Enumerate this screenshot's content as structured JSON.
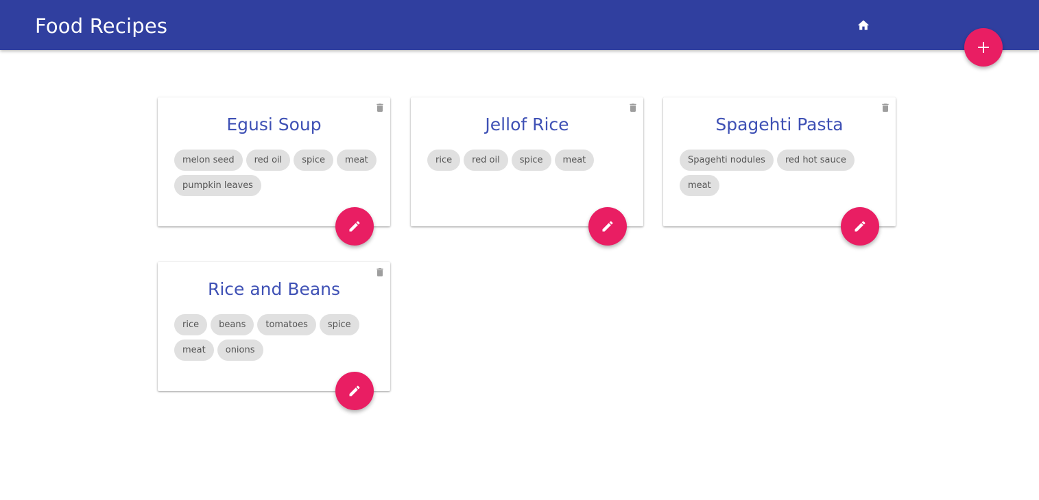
{
  "app": {
    "title": "Food Recipes",
    "home_icon": "home-icon",
    "add_icon": "plus-icon",
    "primary_color": "#303f9f",
    "accent_color": "#e91e63",
    "title_color": "#3f51b5"
  },
  "recipes": [
    {
      "title": "Egusi Soup",
      "ingredients": [
        "melon seed",
        "red oil",
        "spice",
        "meat",
        "pumpkin leaves"
      ]
    },
    {
      "title": "Jellof Rice",
      "ingredients": [
        "rice",
        "red oil",
        "spice",
        "meat"
      ]
    },
    {
      "title": "Spagehti Pasta",
      "ingredients": [
        "Spagehti nodules",
        "red hot sauce",
        "meat"
      ]
    },
    {
      "title": "Rice and Beans",
      "ingredients": [
        "rice",
        "beans",
        "tomatoes",
        "spice",
        "meat",
        "onions"
      ]
    }
  ],
  "card_icons": {
    "delete": "trash-icon",
    "edit": "pencil-icon"
  }
}
